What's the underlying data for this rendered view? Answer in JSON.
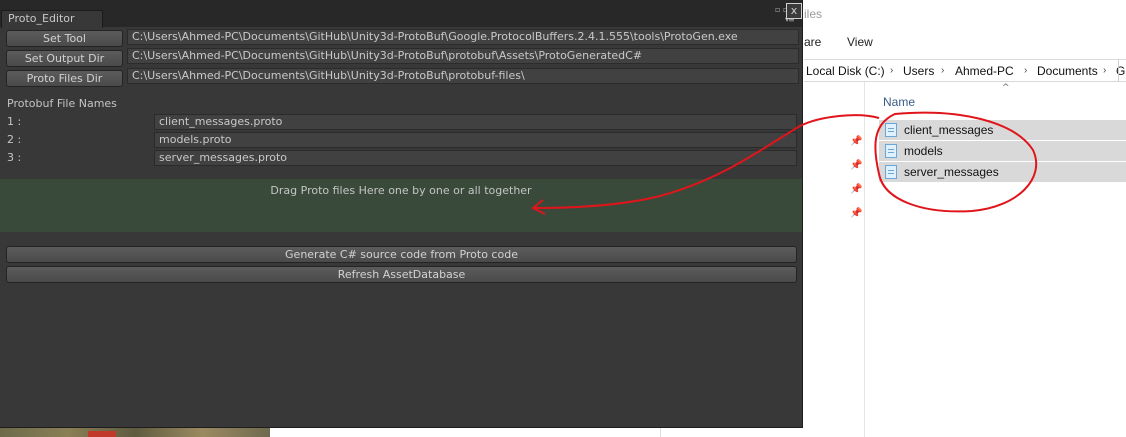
{
  "explorer": {
    "title_fragment": "iles",
    "ribbon": {
      "share": "are",
      "view": "View"
    },
    "address_parts": [
      "Local Disk (C:)",
      "Users",
      "Ahmed-PC",
      "Documents",
      "G"
    ],
    "column_header": "Name",
    "sort_glyph": "^",
    "pin_glyph": "📌",
    "files": [
      {
        "name": "client_messages"
      },
      {
        "name": "models"
      },
      {
        "name": "server_messages"
      }
    ]
  },
  "unity": {
    "tab_title": "Proto_Editor",
    "close_glyph": "x",
    "window_icons": "▫ ▫",
    "menu_glyph": "▾≡",
    "paths": [
      {
        "button": "Set Tool",
        "value": "C:\\Users\\Ahmed-PC\\Documents\\GitHub\\Unity3d-ProtoBuf\\Google.ProtocolBuffers.2.4.1.555\\tools\\ProtoGen.exe"
      },
      {
        "button": "Set Output Dir",
        "value": "C:\\Users\\Ahmed-PC\\Documents\\GitHub\\Unity3d-ProtoBuf\\protobuf\\Assets\\ProtoGeneratedC#"
      },
      {
        "button": "Proto Files Dir",
        "value": "C:\\Users\\Ahmed-PC\\Documents\\GitHub\\Unity3d-ProtoBuf\\protobuf-files\\"
      }
    ],
    "file_names_header": "Protobuf File Names",
    "file_entries": [
      {
        "index": "1 :",
        "value": "client_messages.proto"
      },
      {
        "index": "2 :",
        "value": "models.proto"
      },
      {
        "index": "3 :",
        "value": "server_messages.proto"
      }
    ],
    "drop_area_label": "Drag Proto files Here one by one or all together",
    "generate_button": "Generate C# source code from Proto code",
    "refresh_button": "Refresh AssetDatabase"
  },
  "colors": {
    "unity_bg": "#383838",
    "drop_zone": "#3a4a3a",
    "annotation_red": "#e0151b",
    "selection_gray": "#d9d9d9"
  }
}
